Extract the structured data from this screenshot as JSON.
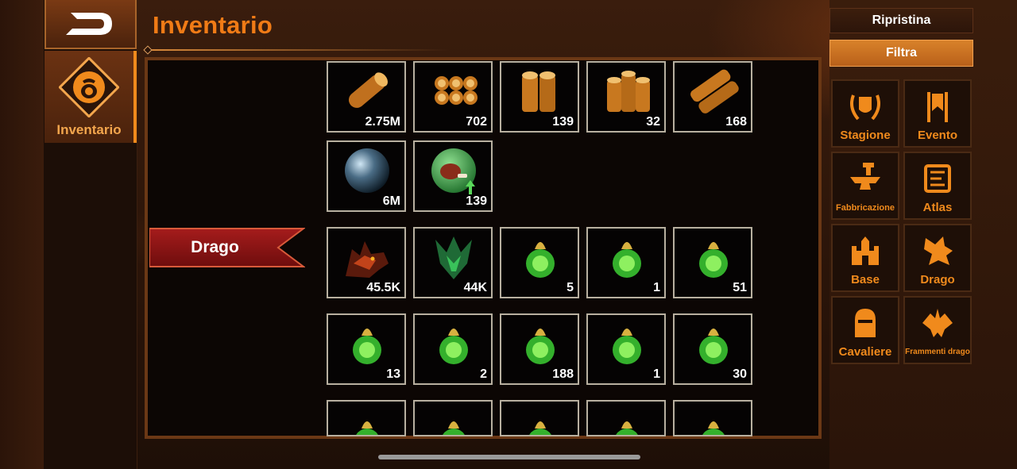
{
  "sidebar": {
    "back_icon": "back-arrow-icon",
    "tab_label": "Inventario",
    "tab_icon": "bag-icon"
  },
  "header": {
    "title": "Inventario"
  },
  "category_ribbon": {
    "label": "Drago",
    "color": "#8f1414"
  },
  "items": {
    "row1": [
      {
        "icon": "wood-log-icon",
        "qty": "2.75M"
      },
      {
        "icon": "wood-bundle-icon",
        "qty": "702"
      },
      {
        "icon": "wood-pair-icon",
        "qty": "139"
      },
      {
        "icon": "wood-stack-icon",
        "qty": "32"
      },
      {
        "icon": "wood-plank-icon",
        "qty": "168"
      }
    ],
    "row2": [
      {
        "icon": "steel-orb-icon",
        "qty": "6M"
      },
      {
        "icon": "meat-boost-icon",
        "qty": "139"
      }
    ],
    "row3": [
      {
        "icon": "red-dragon-icon",
        "qty": "45.5K"
      },
      {
        "icon": "green-dragon-icon",
        "qty": "44K"
      },
      {
        "icon": "dragon-essence-icon",
        "qty": "5"
      },
      {
        "icon": "dragon-essence-icon",
        "qty": "1"
      },
      {
        "icon": "dragon-essence-icon",
        "qty": "51"
      }
    ],
    "row4": [
      {
        "icon": "dragon-essence-icon",
        "qty": "13"
      },
      {
        "icon": "dragon-essence-icon",
        "qty": "2"
      },
      {
        "icon": "dragon-essence-icon",
        "qty": "188"
      },
      {
        "icon": "dragon-essence-icon",
        "qty": "1"
      },
      {
        "icon": "dragon-essence-icon",
        "qty": "30"
      }
    ]
  },
  "filters": {
    "reset_label": "Ripristina",
    "filter_label": "Filtra",
    "categories": [
      {
        "label": "Stagione",
        "icon": "laurel-crest-icon"
      },
      {
        "label": "Evento",
        "icon": "event-banner-icon"
      },
      {
        "label": "Fabbricazione",
        "icon": "anvil-icon"
      },
      {
        "label": "Atlas",
        "icon": "scroll-map-icon"
      },
      {
        "label": "Base",
        "icon": "castle-icon"
      },
      {
        "label": "Drago",
        "icon": "dragon-head-icon"
      },
      {
        "label": "Cavaliere",
        "icon": "knight-helmet-icon"
      },
      {
        "label": "Frammenti drago",
        "icon": "dragon-fragment-icon"
      }
    ]
  },
  "colors": {
    "accent": "#f07b16",
    "panel_border": "#6b3815",
    "slot_border": "#b8b0a0"
  }
}
